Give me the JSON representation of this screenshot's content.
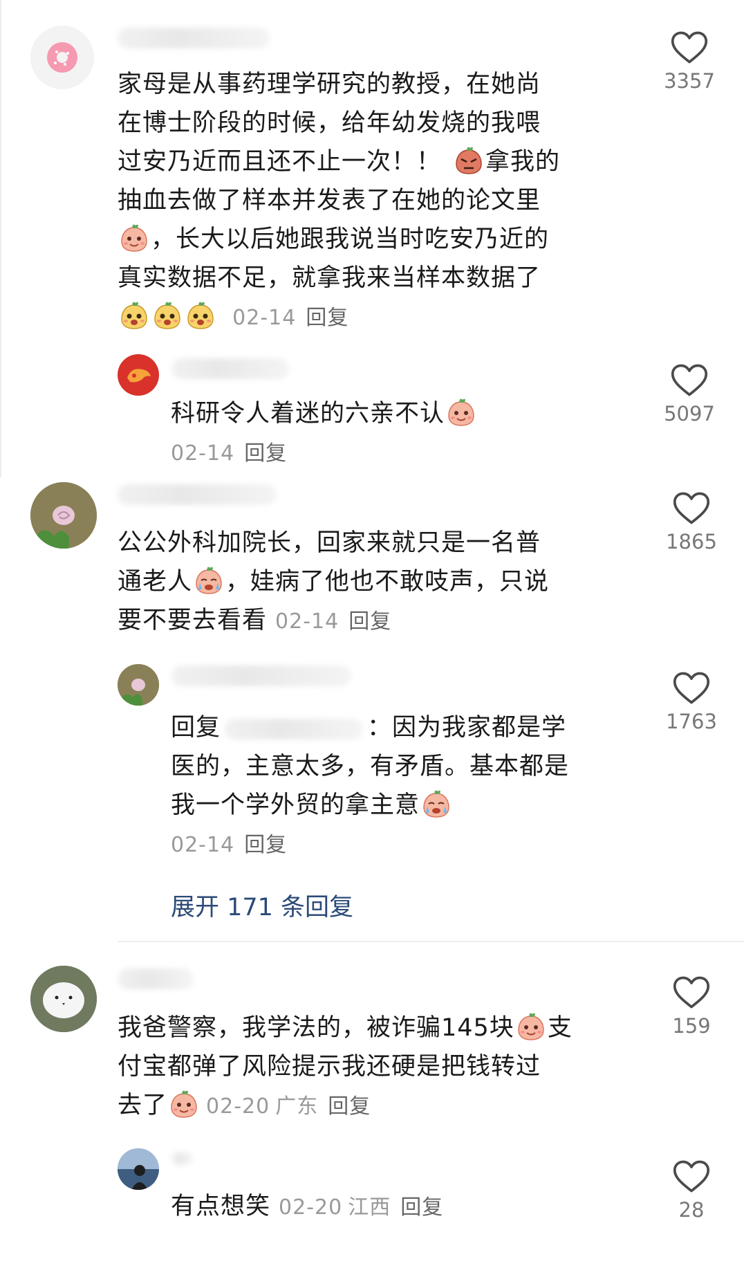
{
  "colors": {
    "link": "#2b4a78",
    "meta": "#999999",
    "text": "#1a1a1a"
  },
  "comments": [
    {
      "avatar_icon": "donut-avatar-icon",
      "lines": [
        "家母是从事药理学研究的教授，在她尚",
        "在博士阶段的时候，给年幼发烧的我喂",
        "过安乃近而且还不止一次！！",
        "拿我的",
        "抽血去做了样本并发表了在她的论文里",
        "，长大以后她跟我说当时吃安乃近的",
        "真实数据不足，就拿我来当样本数据了"
      ],
      "date": "02-14",
      "location": "",
      "reply": "回复",
      "likes": "3357"
    },
    {
      "avatar_icon": "red-logo-avatar-icon",
      "lines": [
        "科研令人着迷的六亲不认"
      ],
      "date": "02-14",
      "location": "",
      "reply": "回复",
      "likes": "5097"
    },
    {
      "avatar_icon": "snail-avatar-icon",
      "lines": [
        "公公外科加院长，回家来就只是一名普",
        "通老人",
        "，娃病了他也不敢吱声，只说",
        "要不要去看看"
      ],
      "date": "02-14",
      "location": "",
      "reply": "回复",
      "likes": "1865"
    },
    {
      "avatar_icon": "snail-avatar-icon",
      "lines": [
        "回复",
        "：因为我家都是学",
        "医的，主意太多，有矛盾。基本都是",
        "我一个学外贸的拿主意"
      ],
      "date": "02-14",
      "location": "",
      "reply": "回复",
      "likes": "1763"
    },
    {
      "avatar_icon": "white-bird-avatar-icon",
      "lines": [
        "我爸警察，我学法的，被诈骗145块",
        "支",
        "付宝都弹了风险提示我还硬是把钱转过",
        "去了"
      ],
      "date": "02-20",
      "location": "广东",
      "reply": "回复",
      "likes": "159"
    },
    {
      "avatar_icon": "person-avatar-icon",
      "lines": [
        "有点想笑"
      ],
      "date": "02-20",
      "location": "江西",
      "reply": "回复",
      "likes": "28"
    }
  ],
  "expand": {
    "label": "展开 171 条回复"
  }
}
